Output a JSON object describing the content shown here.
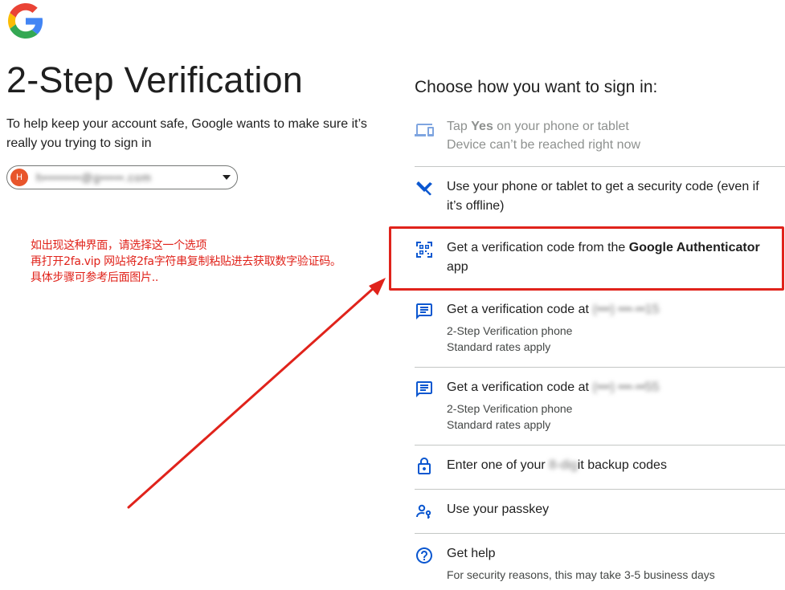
{
  "header": {
    "logo": "google-g-logo",
    "title": "2-Step Verification",
    "subtitle": "To help keep your account safe, Google wants to make sure it’s really you trying to sign in"
  },
  "account": {
    "avatar_letter": "H",
    "email_blurred": "h••••••••@g•••••.com"
  },
  "annotation": {
    "line1": "如出现这种界面，请选择这一个选项",
    "line2": "再打开2fa.vip 网站将2fa字符串复制粘贴进去获取数字验证码。",
    "line3": "具体步骤可参考后面图片.."
  },
  "choose_title": "Choose how you want to sign in:",
  "options": {
    "tap_yes": {
      "pre": "Tap ",
      "bold": "Yes",
      "post": " on your phone or tablet",
      "sub": "Device can’t be reached right now"
    },
    "offline_code": {
      "label": "Use your phone or tablet to get a security code (even if it’s offline)"
    },
    "authenticator": {
      "pre": "Get a verification code from the ",
      "bold": "Google Authenticator",
      "post": " app"
    },
    "sms1": {
      "label": "Get a verification code at ",
      "phone_blurred": "(•••) •••-••15",
      "sub1": "2-Step Verification phone",
      "sub2": "Standard rates apply"
    },
    "sms2": {
      "label": "Get a verification code at ",
      "phone_blurred": "(•••) •••-••55",
      "sub1": "2-Step Verification phone",
      "sub2": "Standard rates apply"
    },
    "backup": {
      "pre": "Enter one of your ",
      "blurred": "8-dig",
      "post": "it backup codes"
    },
    "passkey": {
      "label": "Use your passkey"
    },
    "help": {
      "label": "Get help",
      "sub": "For security reasons, this may take 3-5 business days"
    }
  },
  "colors": {
    "google_blue": "#4285F4",
    "google_red": "#EA4335",
    "google_yellow": "#FBBC05",
    "google_green": "#34A853",
    "icon_blue": "#0b57d0",
    "disabled_blue": "#7fa5e0",
    "annotation_red": "#e0231b",
    "avatar_orange": "#e8552b"
  }
}
